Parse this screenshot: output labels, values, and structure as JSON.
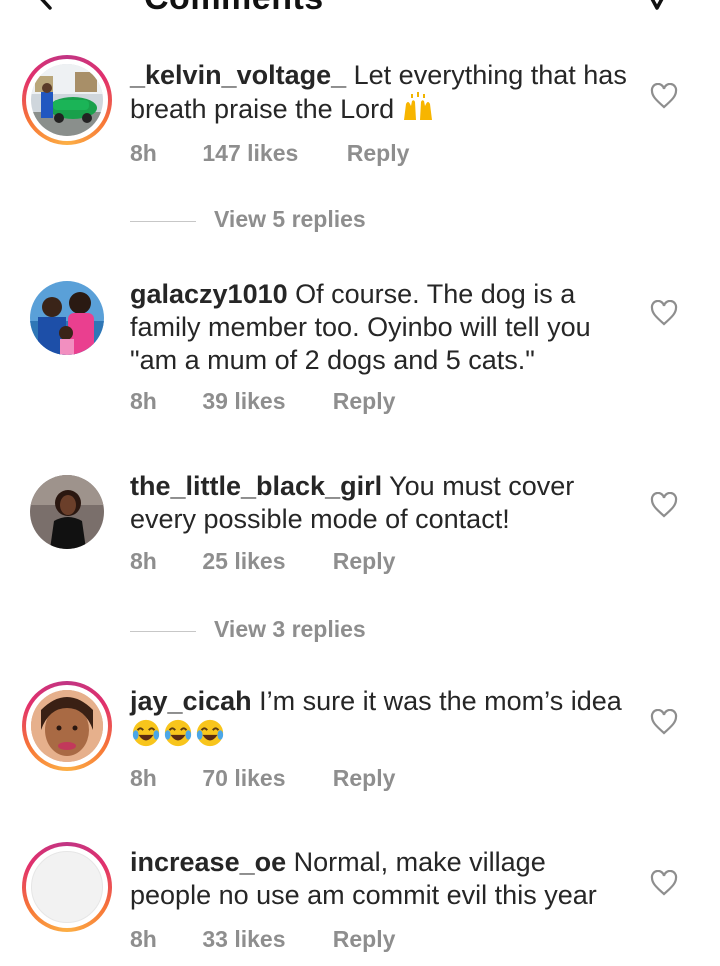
{
  "header": {
    "title": "Comments"
  },
  "comments": [
    {
      "username": "_kelvin_voltage_",
      "text": "Let everything that has breath praise the Lord",
      "time": "8h",
      "likes": "147 likes",
      "reply": "Reply",
      "view_replies": "View 5 replies"
    },
    {
      "username": "galaczy1010",
      "text": "Of course. The dog is a family member too. Oyinbo will tell you \"am a mum of 2 dogs and 5 cats.\"",
      "time": "8h",
      "likes": "39 likes",
      "reply": "Reply"
    },
    {
      "username": "the_little_black_girl",
      "text": "You must cover every possible mode of contact!",
      "time": "8h",
      "likes": "25 likes",
      "reply": "Reply",
      "view_replies": "View 3 replies"
    },
    {
      "username": "jay_cicah",
      "text": "I’m sure it was the mom’s idea",
      "time": "8h",
      "likes": "70 likes",
      "reply": "Reply"
    },
    {
      "username": "increase_oe",
      "text": "Normal, make village people no use am commit evil this year",
      "time": "8h",
      "likes": "33 likes",
      "reply": "Reply"
    }
  ],
  "colors": {
    "text": "#262626",
    "meta": "#8e8e8e",
    "story_ring": "#e1306c"
  }
}
